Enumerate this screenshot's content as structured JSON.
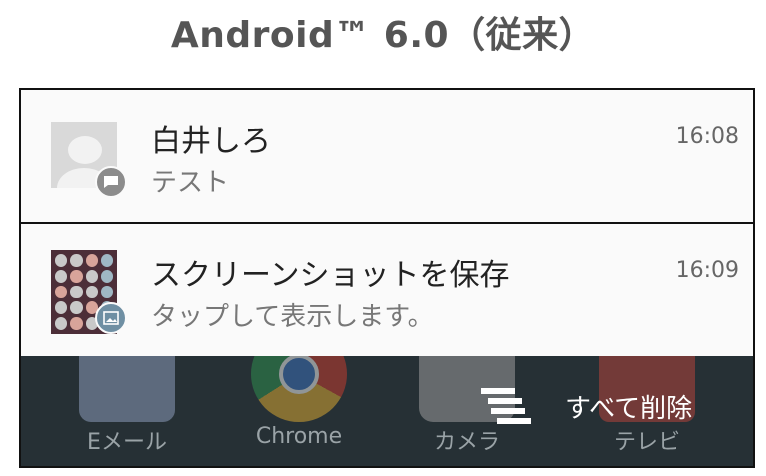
{
  "header": {
    "title": "Android™ 6.0（従来）"
  },
  "notifications": [
    {
      "title": "白井しろ",
      "text": "テスト",
      "time": "16:08",
      "icon": "contact-avatar-icon",
      "badge": "sms-icon"
    },
    {
      "title": "スクリーンショットを保存",
      "text": "タップして表示します。",
      "time": "16:09",
      "icon": "screenshot-thumbnail",
      "badge": "image-icon"
    }
  ],
  "home": {
    "apps": [
      {
        "label": "Eメール",
        "icon": "email-app-icon"
      },
      {
        "label": "Chrome",
        "icon": "chrome-app-icon"
      },
      {
        "label": "カメラ",
        "icon": "camera-app-icon"
      },
      {
        "label": "テレビ",
        "icon": "tv-app-icon"
      }
    ]
  },
  "actions": {
    "clear_all_label": "すべて削除",
    "clear_all_icon": "clear-all-icon"
  },
  "colors": {
    "notification_bg": "#fafafa",
    "home_bg": "#263035",
    "picture_badge": "#6f8fa3"
  }
}
